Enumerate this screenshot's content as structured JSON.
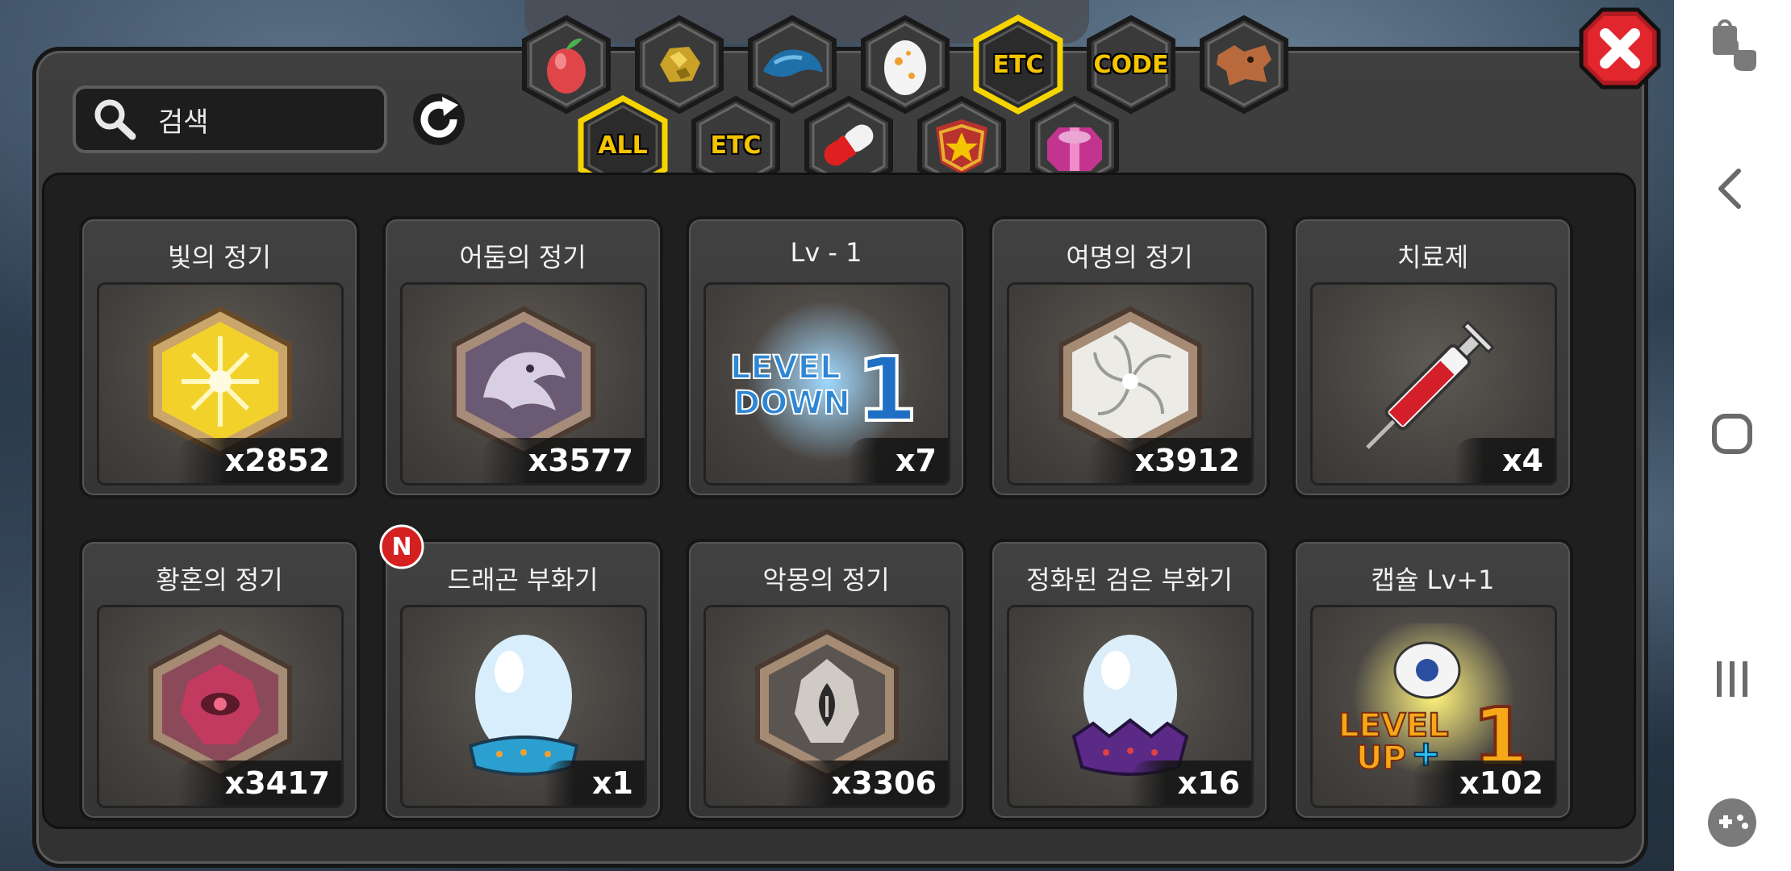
{
  "search": {
    "label": "검색"
  },
  "category_tabs_row1": [
    {
      "name": "fruit-tab",
      "label": ""
    },
    {
      "name": "ore-tab",
      "label": ""
    },
    {
      "name": "dragon-scale-tab",
      "label": ""
    },
    {
      "name": "egg-tab",
      "label": ""
    },
    {
      "name": "etc-tab",
      "label": "ETC",
      "selected": true
    },
    {
      "name": "code-tab",
      "label": "CODE"
    },
    {
      "name": "dragon-head-tab",
      "label": ""
    }
  ],
  "category_tabs_row2": [
    {
      "name": "all-tab",
      "label": "ALL",
      "selected": true
    },
    {
      "name": "etc-sub-tab",
      "label": "ETC"
    },
    {
      "name": "capsule-tab",
      "label": ""
    },
    {
      "name": "medal-tab",
      "label": ""
    },
    {
      "name": "gift-box-tab",
      "label": ""
    }
  ],
  "items": [
    {
      "title": "빛의 정기",
      "count": "x2852",
      "icon": "light-essence-icon"
    },
    {
      "title": "어둠의 정기",
      "count": "x3577",
      "icon": "dark-essence-icon"
    },
    {
      "title": "Lv - 1",
      "count": "x7",
      "icon": "level-down-icon",
      "art_text": "LEVEL DOWN 1"
    },
    {
      "title": "여명의 정기",
      "count": "x3912",
      "icon": "dawn-essence-icon"
    },
    {
      "title": "치료제",
      "count": "x4",
      "icon": "syringe-icon"
    },
    {
      "title": "황혼의 정기",
      "count": "x3417",
      "icon": "twilight-essence-icon"
    },
    {
      "title": "드래곤 부화기",
      "count": "x1",
      "icon": "dragon-incubator-icon",
      "badge": "N"
    },
    {
      "title": "악몽의 정기",
      "count": "x3306",
      "icon": "nightmare-essence-icon"
    },
    {
      "title": "정화된 검은 부화기",
      "count": "x16",
      "icon": "purified-black-incubator-icon"
    },
    {
      "title": "캡슐 Lv+1",
      "count": "x102",
      "icon": "level-up-capsule-icon",
      "art_text": "LEVEL UP+1"
    }
  ],
  "colors": {
    "tab_selected_border": "#f5d400",
    "accent_text": "#f5c400",
    "close_red": "#d8222a"
  }
}
